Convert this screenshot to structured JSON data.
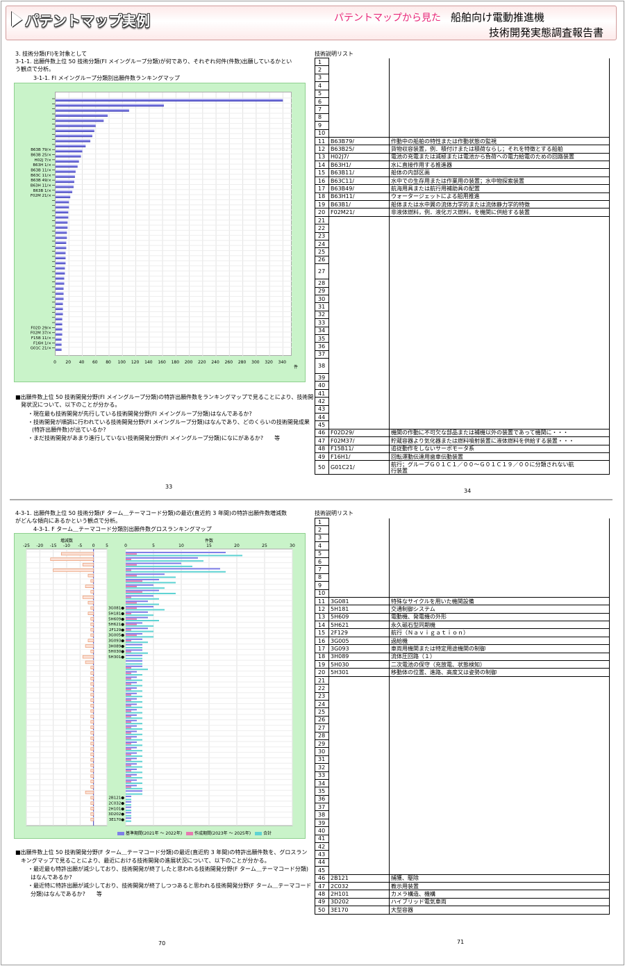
{
  "header": {
    "title": "パテントマップ実例",
    "subtitle": "パテントマップから見た",
    "product": "船舶向け電動推進機",
    "report": "技術開発実態調査報告書"
  },
  "p33": {
    "heading": "3. 技術分類(FI)を対象として",
    "q1": "3-1-1. 出願件数上位 50 技術分類(FI メイングループ分類)が何であり、それぞれ何件(件数)出願しているかとい",
    "q2": "う観点で分析。",
    "caption": "3-1-1. FI メイングループ分類別出願件数ランキングマップ",
    "s1": "■出願件数上位 50 技術開発分野(FI メイングループ分類)の特許出願件数をランキングマップで見ることにより、技術開",
    "s2": "発状況について、以下のことが分かる。",
    "b1": "・現在最も技術開発が先行している技術開発分野(FI メイングループ分類)はなんであるか?",
    "b2": "・技術開発が順調に行われている技術開発分野(FI メイングループ分類)はなんであり、どのくらいの技術開発成果",
    "b2b": "(特許出願件数)が出ているか?",
    "b3": "・まだ技術開発があまり進行していない技術開発分野(FI メイングループ分類)になにがあるか?　　等",
    "page": "33"
  },
  "p34": {
    "title": "技術説明リスト",
    "page": "34",
    "rows": [
      {
        "no": "1",
        "code": "",
        "desc": ""
      },
      {
        "no": "2",
        "code": "",
        "desc": ""
      },
      {
        "no": "3",
        "code": "",
        "desc": ""
      },
      {
        "no": "4",
        "code": "",
        "desc": ""
      },
      {
        "no": "5",
        "code": "",
        "desc": ""
      },
      {
        "no": "6",
        "code": "",
        "desc": ""
      },
      {
        "no": "7",
        "code": "",
        "desc": ""
      },
      {
        "no": "8",
        "code": "",
        "desc": ""
      },
      {
        "no": "9",
        "code": "",
        "desc": ""
      },
      {
        "no": "10",
        "code": "",
        "desc": ""
      },
      {
        "no": "11",
        "code": "B63B79/",
        "desc": "作動中の船舶の特性または作動状態の監視"
      },
      {
        "no": "12",
        "code": "B63B25/",
        "desc": "貨物収容装置，例．積付けまたは積荷ならし；それを特徴とする船舶"
      },
      {
        "no": "13",
        "code": "H02J7/",
        "desc": "電池の充電または減極または電池から負荷への電力給電のための回路装置"
      },
      {
        "no": "14",
        "code": "B63H1/",
        "desc": "水に直接作用する推進器"
      },
      {
        "no": "15",
        "code": "B63B11/",
        "desc": "船体の内部区画"
      },
      {
        "no": "16",
        "code": "B63C11/",
        "desc": "水中での生存用または作業用の装置；水中物探索装置"
      },
      {
        "no": "17",
        "code": "B63B49/",
        "desc": "航海用具または航行用補助具の配置"
      },
      {
        "no": "18",
        "code": "B63H11/",
        "desc": "ウォータージェットによる船用推進"
      },
      {
        "no": "19",
        "code": "B63B1/",
        "desc": "船体または水中翼の流体力学的または流体静力学的特徴"
      },
      {
        "no": "20",
        "code": "F02M21/",
        "desc": "非液体燃料，例．液化ガス燃料，を機関に供給する装置"
      },
      {
        "no": "21",
        "code": "",
        "desc": ""
      },
      {
        "no": "22",
        "code": "",
        "desc": ""
      },
      {
        "no": "23",
        "code": "",
        "desc": ""
      },
      {
        "no": "24",
        "code": "",
        "desc": ""
      },
      {
        "no": "25",
        "code": "",
        "desc": ""
      },
      {
        "no": "26",
        "code": "",
        "desc": ""
      },
      {
        "no": "27",
        "code": "",
        "desc": ""
      },
      {
        "no": "28",
        "code": "",
        "desc": ""
      },
      {
        "no": "29",
        "code": "",
        "desc": ""
      },
      {
        "no": "30",
        "code": "",
        "desc": ""
      },
      {
        "no": "31",
        "code": "",
        "desc": ""
      },
      {
        "no": "32",
        "code": "",
        "desc": ""
      },
      {
        "no": "33",
        "code": "",
        "desc": ""
      },
      {
        "no": "34",
        "code": "",
        "desc": ""
      },
      {
        "no": "35",
        "code": "",
        "desc": ""
      },
      {
        "no": "36",
        "code": "",
        "desc": ""
      },
      {
        "no": "37",
        "code": "",
        "desc": ""
      },
      {
        "no": "38",
        "code": "",
        "desc": ""
      },
      {
        "no": "39",
        "code": "",
        "desc": ""
      },
      {
        "no": "40",
        "code": "",
        "desc": ""
      },
      {
        "no": "41",
        "code": "",
        "desc": ""
      },
      {
        "no": "42",
        "code": "",
        "desc": ""
      },
      {
        "no": "43",
        "code": "",
        "desc": ""
      },
      {
        "no": "44",
        "code": "",
        "desc": ""
      },
      {
        "no": "45",
        "code": "",
        "desc": ""
      },
      {
        "no": "46",
        "code": "F02D29/",
        "desc": "機関の作動に不可欠な部品または補機以外の装置であって機関に・・・"
      },
      {
        "no": "47",
        "code": "F02M37/",
        "desc": "貯蔵容器より気化器または燃料噴射装置に液体燃料を供給する装置・・・"
      },
      {
        "no": "48",
        "code": "F15B11/",
        "desc": "追従動作をしないサーボモータ系"
      },
      {
        "no": "49",
        "code": "F16H1/",
        "desc": "回転運動伝達用歯車伝動装置"
      },
      {
        "no": "50",
        "code": "G01C21/",
        "desc": "航行；グループＧ０１Ｃ１／００～Ｇ０１Ｃ１９／００に分類されない航",
        "desc2": "行装置"
      }
    ]
  },
  "p70": {
    "q1": "4-3-1. 出願件数上位 50 技術分類(F ターム＿テーマコード分類)の最近(直近約 3 年間)の特許出願件数増減数",
    "q2": "がどんな傾向にあるかという観点で分析。",
    "caption": "4-3-1. F ターム＿テーマコード分類別出願件数グロスランキングマップ",
    "legend": [
      "基準期間(2021年 ～ 2022年)",
      "作成期間(2023年 ～ 2025年)",
      "合計"
    ],
    "s1": "■出願件数上位 50 技術開発分野(F ターム＿テーマコード分類)の最近(直近約 3 年間)の特許出願件数を、グロスラン",
    "s2": "キングマップで見ることにより、最近における技術開発の進展状況について、以下のことが分かる。",
    "b1": "・最近最も特許出願が減少しており、技術開発が終了したと思われる技術開発分野(F ターム＿テーマコード分類)",
    "b1b": "はなんであるか?",
    "b2": "・最近特に特許出願が減少しており、技術開発が終了しつつあると思われる技術開発分野(F ターム＿テーマコード",
    "b2b": "分類)はなんであるか?　　等",
    "page": "70"
  },
  "p71": {
    "title": "技術説明リスト",
    "page": "71",
    "rows": [
      {
        "no": "1",
        "code": "",
        "desc": ""
      },
      {
        "no": "2",
        "code": "",
        "desc": ""
      },
      {
        "no": "3",
        "code": "",
        "desc": ""
      },
      {
        "no": "4",
        "code": "",
        "desc": ""
      },
      {
        "no": "5",
        "code": "",
        "desc": ""
      },
      {
        "no": "6",
        "code": "",
        "desc": ""
      },
      {
        "no": "7",
        "code": "",
        "desc": ""
      },
      {
        "no": "8",
        "code": "",
        "desc": ""
      },
      {
        "no": "9",
        "code": "",
        "desc": ""
      },
      {
        "no": "10",
        "code": "",
        "desc": ""
      },
      {
        "no": "11",
        "code": "3G081",
        "desc": "特殊なサイクルを用いた機関設備"
      },
      {
        "no": "12",
        "code": "5H181",
        "desc": "交通制御システム"
      },
      {
        "no": "13",
        "code": "5H609",
        "desc": "電動機、発電機の外形"
      },
      {
        "no": "14",
        "code": "5H621",
        "desc": "永久磁石型同期機"
      },
      {
        "no": "15",
        "code": "2F129",
        "desc": "航行（Ｎａｖｉｇａｔｉｏｎ）"
      },
      {
        "no": "16",
        "code": "3G005",
        "desc": "過給機"
      },
      {
        "no": "17",
        "code": "3G093",
        "desc": "車両用機関または特定用途機関の制御"
      },
      {
        "no": "18",
        "code": "3H089",
        "desc": "流体圧回路（１）"
      },
      {
        "no": "19",
        "code": "5H030",
        "desc": "二次電池の保守（充放電、状態検知）"
      },
      {
        "no": "20",
        "code": "5H301",
        "desc": "移動体の位置、進路、高度又は姿勢の制御"
      },
      {
        "no": "21",
        "code": "",
        "desc": ""
      },
      {
        "no": "22",
        "code": "",
        "desc": ""
      },
      {
        "no": "23",
        "code": "",
        "desc": ""
      },
      {
        "no": "24",
        "code": "",
        "desc": ""
      },
      {
        "no": "25",
        "code": "",
        "desc": ""
      },
      {
        "no": "26",
        "code": "",
        "desc": ""
      },
      {
        "no": "27",
        "code": "",
        "desc": ""
      },
      {
        "no": "28",
        "code": "",
        "desc": ""
      },
      {
        "no": "29",
        "code": "",
        "desc": ""
      },
      {
        "no": "30",
        "code": "",
        "desc": ""
      },
      {
        "no": "31",
        "code": "",
        "desc": ""
      },
      {
        "no": "32",
        "code": "",
        "desc": ""
      },
      {
        "no": "33",
        "code": "",
        "desc": ""
      },
      {
        "no": "34",
        "code": "",
        "desc": ""
      },
      {
        "no": "35",
        "code": "",
        "desc": ""
      },
      {
        "no": "36",
        "code": "",
        "desc": ""
      },
      {
        "no": "37",
        "code": "",
        "desc": ""
      },
      {
        "no": "38",
        "code": "",
        "desc": ""
      },
      {
        "no": "39",
        "code": "",
        "desc": ""
      },
      {
        "no": "40",
        "code": "",
        "desc": ""
      },
      {
        "no": "41",
        "code": "",
        "desc": ""
      },
      {
        "no": "42",
        "code": "",
        "desc": ""
      },
      {
        "no": "43",
        "code": "",
        "desc": ""
      },
      {
        "no": "44",
        "code": "",
        "desc": ""
      },
      {
        "no": "45",
        "code": "",
        "desc": ""
      },
      {
        "no": "46",
        "code": "2B121",
        "desc": "捕獲、駆除"
      },
      {
        "no": "47",
        "code": "2C032",
        "desc": "教示用装置"
      },
      {
        "no": "48",
        "code": "2H101",
        "desc": "カメラ構造、機構"
      },
      {
        "no": "49",
        "code": "3D202",
        "desc": "ハイブリッド電気車両"
      },
      {
        "no": "50",
        "code": "3E170",
        "desc": "大型容器"
      }
    ]
  },
  "chart_data": [
    {
      "type": "bar",
      "orientation": "horizontal",
      "title": "",
      "xlabel": "件",
      "xlim": [
        0,
        350
      ],
      "xticks": [
        0,
        20,
        40,
        60,
        80,
        100,
        120,
        140,
        160,
        180,
        200,
        220,
        240,
        260,
        280,
        300,
        320,
        340
      ],
      "categories": [
        "",
        "",
        "",
        "",
        "",
        "",
        "",
        "",
        "",
        "",
        "B63B 79/×",
        "B63B 25/×",
        "H02J 7/×",
        "B63H 1/×",
        "B63B 11/×",
        "B63C 11/×",
        "B63B 49/×",
        "B63H 11/×",
        "B63B 1/×",
        "F02M 21/×",
        "",
        "",
        "",
        "",
        "",
        "",
        "",
        "",
        "",
        "",
        "",
        "",
        "",
        "",
        "",
        "",
        "",
        "",
        "",
        "",
        "",
        "",
        "",
        "",
        "",
        "F02D 29/×",
        "F02M 37/×",
        "F15B 11/×",
        "F16H 1/×",
        "G01C 21/×"
      ],
      "values": [
        340,
        162,
        110,
        78,
        72,
        60,
        58,
        55,
        52,
        45,
        40,
        38,
        35,
        33,
        30,
        29,
        28,
        27,
        25,
        22,
        20,
        20,
        19,
        19,
        18,
        18,
        17,
        17,
        16,
        16,
        15,
        15,
        15,
        14,
        14,
        13,
        13,
        12,
        12,
        12,
        11,
        11,
        11,
        10,
        10,
        10,
        10,
        9,
        9,
        9
      ],
      "grid": true
    },
    {
      "type": "bar",
      "orientation": "horizontal",
      "title": "",
      "panels": [
        {
          "name": "増減数",
          "xlim": [
            -25,
            5
          ],
          "xticks": [
            -25,
            -20,
            -15,
            -10,
            -5,
            0,
            5
          ]
        },
        {
          "name": "件数",
          "xlim": [
            0,
            30
          ],
          "xticks": [
            0,
            5,
            10,
            15,
            20,
            25,
            30
          ]
        }
      ],
      "categories": [
        "",
        "",
        "",
        "",
        "",
        "",
        "",
        "",
        "",
        "",
        "3G081●",
        "5H181●",
        "5H609●",
        "5H621●",
        "2F129●",
        "3G005●",
        "3G093●",
        "3H089●",
        "5H030●",
        "5H301●",
        "",
        "",
        "",
        "",
        "",
        "",
        "",
        "",
        "",
        "",
        "",
        "",
        "",
        "",
        "",
        "",
        "",
        "",
        "",
        "",
        "",
        "",
        "",
        "",
        "",
        "2B121●",
        "2C032●",
        "2H101●",
        "3D202●",
        "3E170●"
      ],
      "change": [
        -12,
        -16,
        -4,
        -15,
        -2,
        -1,
        -3,
        -1,
        -4,
        -2,
        -1,
        -2,
        -1,
        -1,
        -1,
        -1,
        -2,
        -3,
        -1,
        -4,
        -3,
        -1,
        -1,
        -1,
        -1,
        -1,
        -1,
        -1,
        -1,
        -1,
        -1,
        -1,
        -1,
        -1,
        -1,
        -1,
        -1,
        -1,
        -1,
        -1,
        -1,
        -1,
        -1,
        -1,
        -3,
        -1,
        -1,
        -1,
        -1,
        -1
      ],
      "series": [
        {
          "name": "基準期間(2021年 ～ 2022年)",
          "values": [
            18,
            13,
            10,
            17,
            7,
            6,
            5,
            6,
            5,
            4,
            5,
            4,
            4,
            3,
            4,
            3,
            3,
            3,
            3,
            3,
            3,
            3,
            2,
            2,
            2,
            2,
            2,
            2,
            2,
            2,
            2,
            2,
            2,
            2,
            2,
            2,
            2,
            2,
            2,
            2,
            2,
            2,
            2,
            2,
            3,
            1,
            1,
            1,
            1,
            1
          ]
        },
        {
          "name": "作成期間(2023年 ～ 2025年)",
          "values": [
            2,
            1,
            2,
            1,
            2,
            3,
            2,
            3,
            1,
            2,
            2,
            1,
            2,
            2,
            1,
            2,
            1,
            0,
            1,
            0,
            0,
            1,
            1,
            1,
            1,
            1,
            1,
            1,
            1,
            1,
            1,
            1,
            1,
            1,
            1,
            1,
            1,
            1,
            1,
            1,
            1,
            1,
            1,
            1,
            0,
            0,
            0,
            0,
            0,
            0
          ]
        },
        {
          "name": "合計",
          "values": [
            21,
            14,
            12,
            18,
            9,
            9,
            7,
            9,
            6,
            6,
            7,
            5,
            6,
            5,
            5,
            5,
            4,
            3,
            4,
            3,
            3,
            4,
            3,
            3,
            3,
            3,
            3,
            3,
            3,
            3,
            3,
            3,
            3,
            3,
            3,
            3,
            3,
            3,
            3,
            3,
            3,
            3,
            3,
            3,
            3,
            1,
            1,
            1,
            1,
            1
          ]
        }
      ],
      "grid": true
    }
  ]
}
